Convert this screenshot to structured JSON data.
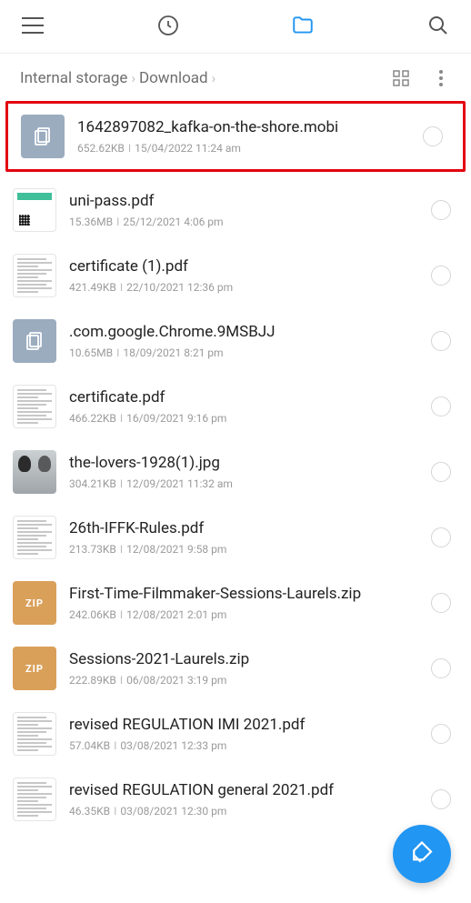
{
  "breadcrumb": {
    "root": "Internal storage",
    "current": "Download"
  },
  "zip_label": "ZIP",
  "files": [
    {
      "name": "1642897082_kafka-on-the-shore.mobi",
      "size": "652.62KB",
      "date": "15/04/2022 11:24 am",
      "highlighted": true,
      "thumb": "generic"
    },
    {
      "name": "uni-pass.pdf",
      "size": "15.36MB",
      "date": "25/12/2021 4:06 pm",
      "thumb": "unipass"
    },
    {
      "name": "certificate (1).pdf",
      "size": "421.49KB",
      "date": "22/10/2021 12:36 pm",
      "thumb": "doc"
    },
    {
      "name": ".com.google.Chrome.9MSBJJ",
      "size": "10.65MB",
      "date": "18/09/2021 8:21 pm",
      "thumb": "generic"
    },
    {
      "name": "certificate.pdf",
      "size": "466.22KB",
      "date": "16/09/2021 9:16 pm",
      "thumb": "doc"
    },
    {
      "name": "the-lovers-1928(1).jpg",
      "size": "304.21KB",
      "date": "12/09/2021 11:32 am",
      "thumb": "photo"
    },
    {
      "name": "26th-IFFK-Rules.pdf",
      "size": "213.73KB",
      "date": "12/08/2021 9:58 pm",
      "thumb": "doc"
    },
    {
      "name": "First-Time-Filmmaker-Sessions-Laurels.zip",
      "size": "242.06KB",
      "date": "12/08/2021 2:01 pm",
      "thumb": "zip"
    },
    {
      "name": "Sessions-2021-Laurels.zip",
      "size": "222.89KB",
      "date": "06/08/2021 3:19 pm",
      "thumb": "zip"
    },
    {
      "name": "revised REGULATION IMI 2021.pdf",
      "size": "57.04KB",
      "date": "03/08/2021 12:33 pm",
      "thumb": "doc"
    },
    {
      "name": "revised REGULATION general 2021.pdf",
      "size": "46.35KB",
      "date": "03/08/2021 12:30 pm",
      "thumb": "doc"
    }
  ]
}
